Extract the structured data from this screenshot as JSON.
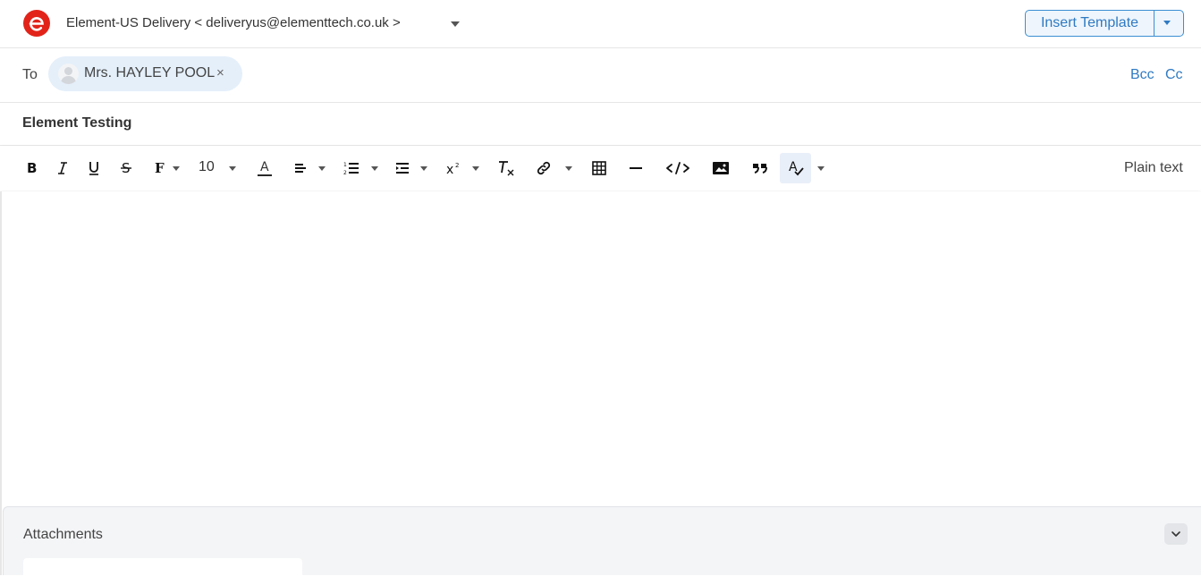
{
  "from": {
    "text": "Element-US Delivery < deliveryus@elementtech.co.uk >"
  },
  "header": {
    "insert_template_label": "Insert Template"
  },
  "recipients": {
    "to_label": "To",
    "to": [
      {
        "name": "Mrs. HAYLEY POOL"
      }
    ],
    "remove_symbol": "×",
    "bcc_label": "Bcc",
    "cc_label": "Cc"
  },
  "subject": "Element Testing",
  "toolbar": {
    "font_size": "10",
    "plain_text_label": "Plain text",
    "items": [
      "bold-icon",
      "italic-icon",
      "underline-icon",
      "strikethrough-icon",
      "font-family-icon",
      "font-size",
      "text-color-icon",
      "align-icon",
      "list-icon",
      "indent-icon",
      "superscript-icon",
      "clear-format-icon",
      "link-icon",
      "table-icon",
      "horizontal-rule-icon",
      "code-icon",
      "image-icon",
      "blockquote-icon",
      "spellcheck-icon"
    ],
    "active_item": "spellcheck-icon"
  },
  "attachments": {
    "title": "Attachments"
  },
  "colors": {
    "accent": "#2f7ac2",
    "brand": "#e2231a",
    "chip_bg": "#e4effa"
  }
}
